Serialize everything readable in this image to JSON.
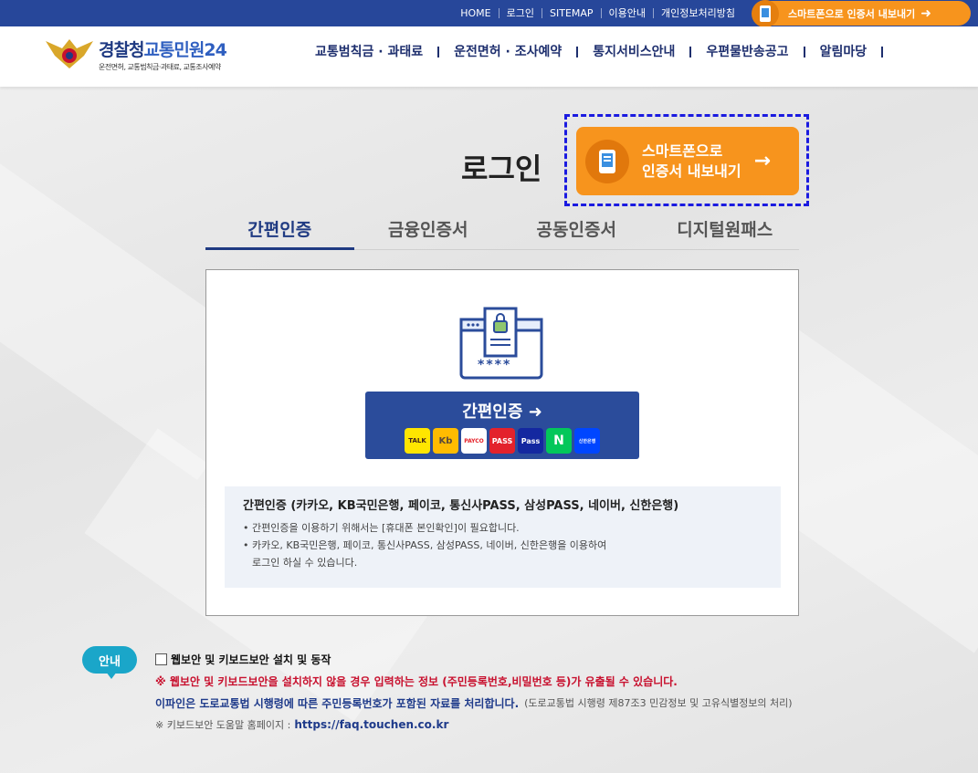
{
  "topbar": {
    "links": [
      "HOME",
      "로그인",
      "SITEMAP",
      "이용안내",
      "개인정보처리방침"
    ],
    "export_label": "스마트폰으로 인증서 내보내기"
  },
  "header": {
    "logo_title_a": "경찰청",
    "logo_title_b": "교통민원24",
    "logo_sub": "운전면허, 교통범칙금·과태료, 교통조사예약",
    "nav": [
      "교통범칙금 · 과태료",
      "운전면허 · 조사예약",
      "통지서비스안내",
      "우편물반송공고",
      "알림마당"
    ]
  },
  "login": {
    "title": "로그인",
    "export_line1": "스마트폰으로",
    "export_line2": "인증서 내보내기",
    "tabs": [
      "간편인증",
      "금융인증서",
      "공동인증서",
      "디지털원패스"
    ],
    "active_tab": 0
  },
  "panel": {
    "illust_mask": "****",
    "easy_button_label": "간편인증",
    "providers": [
      "TALK",
      "Kb",
      "PAYCO",
      "PASS",
      "Pass",
      "N",
      "신한은행"
    ],
    "info_heading": "간편인증 (카카오, KB국민은행, 페이코, 통신사PASS, 삼성PASS, 네이버, 신한은행)",
    "info_line1": "간편인증을 이용하기 위해서는 [휴대폰 본인확인]이 필요합니다.",
    "info_line2": "카카오, KB국민은행, 페이코, 통신사PASS, 삼성PASS, 네이버, 신한은행을 이용하여",
    "info_line2b": "로그인 하실 수 있습니다."
  },
  "notice": {
    "badge": "안내",
    "checkbox_label": "웹보안 및 키보드보안 설치 및 동작",
    "warning": "※ 웹보안 및 키보드보안을 설치하지 않을 경우 입력하는 정보 (주민등록번호,비밀번호 등)가 유출될 수 있습니다.",
    "legal": "이파인은 도로교통법 시행령에 따른 주민등록번호가 포함된 자료를 처리합니다.",
    "legal_ref": "(도로교통법 시행령 제87조3 민감정보 및 고유식별정보의 처리)",
    "help_prefix": "※ 키보드보안 도움말 홈페이지 :",
    "help_url": "https://faq.touchen.co.kr"
  },
  "colors": {
    "navy": "#27479a",
    "orange": "#f7941d",
    "teal": "#1aa6c9",
    "red": "#c8102e"
  }
}
